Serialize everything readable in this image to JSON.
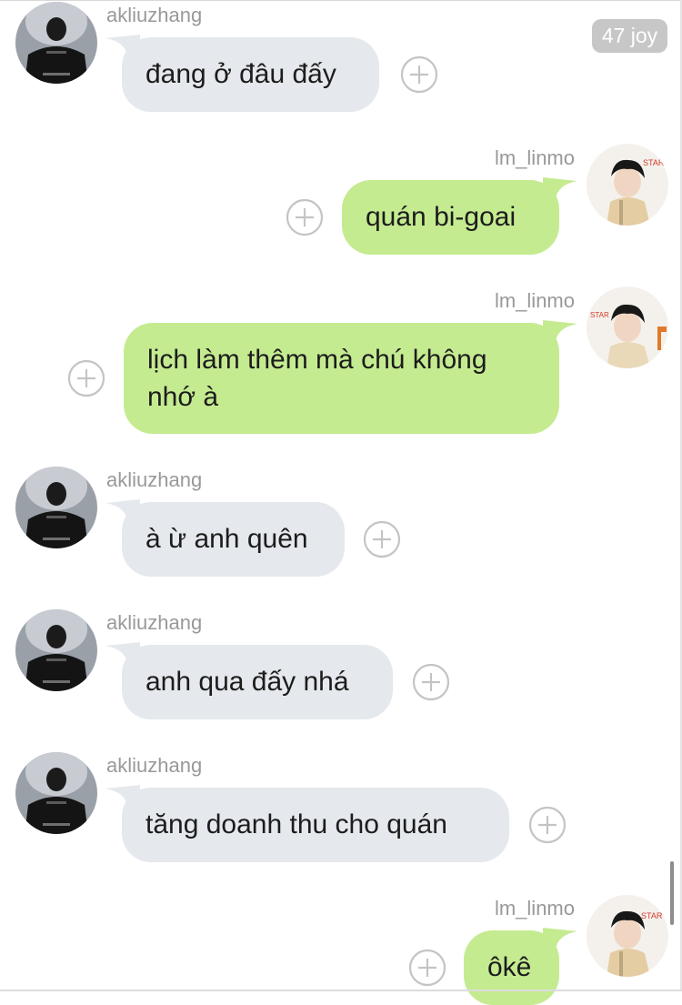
{
  "badge": {
    "label": "47 joy"
  },
  "messages": [
    {
      "sender": "akliuzhang",
      "text": "đang ở đâu đấy"
    },
    {
      "sender": "lm_linmo",
      "text": "quán bi-goai"
    },
    {
      "sender": "lm_linmo",
      "text": "lịch làm thêm mà chú không\nnhớ à"
    },
    {
      "sender": "akliuzhang",
      "text": "à ừ anh quên"
    },
    {
      "sender": "akliuzhang",
      "text": "anh qua đấy nhá"
    },
    {
      "sender": "akliuzhang",
      "text": "tăng doanh thu cho quán"
    },
    {
      "sender": "lm_linmo",
      "text": "ôkê"
    }
  ],
  "colors": {
    "left_bubble": "#e5e8ec",
    "right_bubble": "#c5eb91",
    "name_text": "#999999",
    "badge_bg": "#c7c7c7"
  },
  "icons": {
    "add": "plus-circle-icon"
  }
}
